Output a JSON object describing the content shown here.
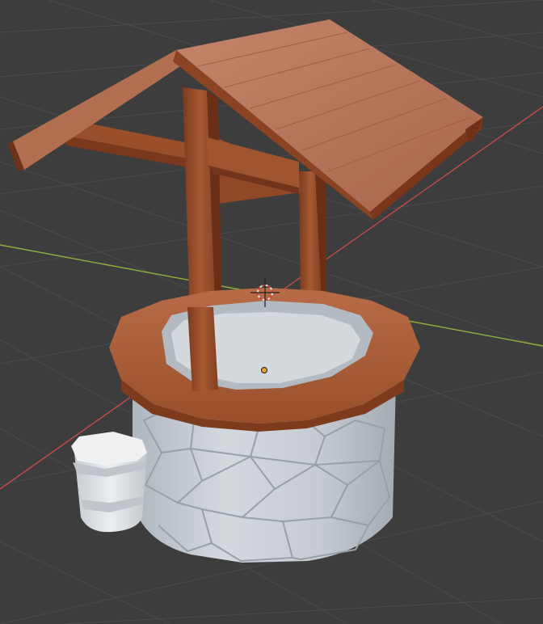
{
  "app": "3D viewport",
  "scene": {
    "object": "wishing-well",
    "parts": [
      "roof",
      "posts",
      "crossbeam",
      "rim",
      "stone-base",
      "bucket"
    ]
  },
  "colors": {
    "background": "#3d3d3d",
    "grid": "#4a4a4a",
    "x_axis": "#c44a4a",
    "y_axis": "#8fb03a",
    "wood": "#a4552e",
    "wood_dark": "#6f3219",
    "roof_top": "#bb7a5f",
    "stone": "#c9cfd5",
    "stone_lines": "#9aa2aa",
    "bucket": "#dde0e4",
    "origin": "#f0a030"
  }
}
